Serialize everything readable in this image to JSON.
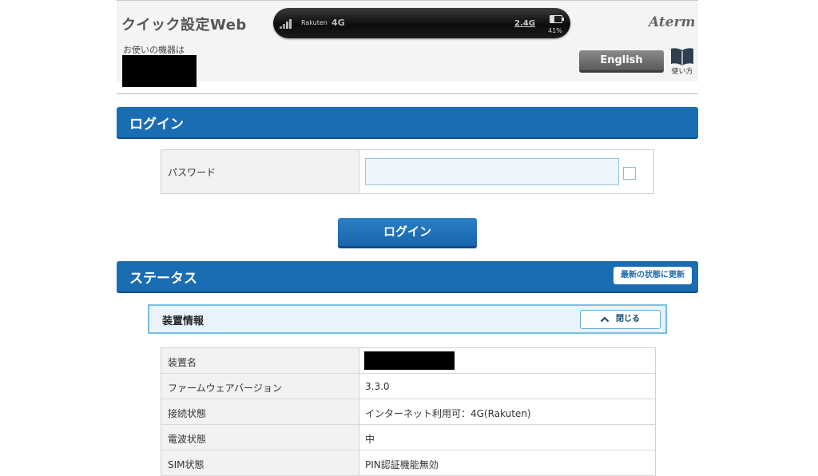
{
  "header": {
    "app_title": "クイック設定Web",
    "device_caption": "お使いの機器は",
    "brand": "Aterm",
    "english_button": "English",
    "manual_label": "使い方",
    "device_status": {
      "carrier": "Rakuten",
      "network": "4G",
      "wifi_band": "2.4G",
      "battery": "41%"
    }
  },
  "login": {
    "section_title": "ログイン",
    "password_label": "パスワード",
    "password_value": "",
    "login_button": "ログイン"
  },
  "status": {
    "section_title": "ステータス",
    "refresh_button": "最新の状態に更新",
    "device_info": {
      "title": "装置情報",
      "close_button": "閉じる",
      "rows": [
        {
          "label": "装置名",
          "value": ""
        },
        {
          "label": "ファームウェアバージョン",
          "value": "3.3.0"
        },
        {
          "label": "接続状態",
          "value": "インターネット利用可：4G(Rakuten)"
        },
        {
          "label": "電波状態",
          "value": "中"
        },
        {
          "label": "SIM状態",
          "value": "PIN認証機能無効"
        }
      ]
    }
  },
  "colors": {
    "section_blue": "#1b6db3",
    "subheader_border": "#77c0e4",
    "button_gray": "#6e6e6e"
  }
}
